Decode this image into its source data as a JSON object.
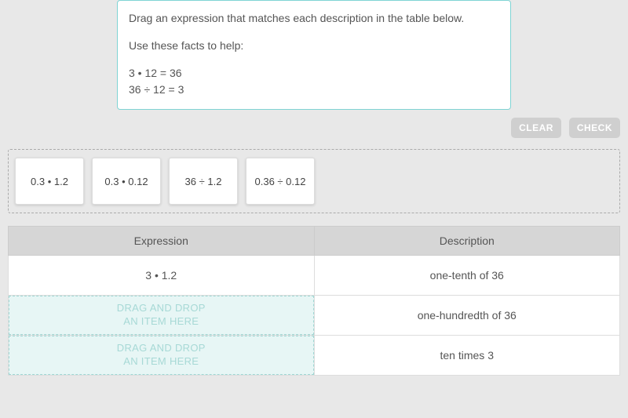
{
  "instructions": {
    "line1": "Drag an expression that matches each description in the table below.",
    "line2": "Use these facts to help:",
    "fact1": "3 • 12 = 36",
    "fact2": "36 ÷ 12 = 3"
  },
  "buttons": {
    "clear": "CLEAR",
    "check": "CHECK"
  },
  "cards": [
    "0.3 • 1.2",
    "0.3 • 0.12",
    "36 ÷ 1.2",
    "0.36 ÷ 0.12"
  ],
  "table": {
    "header_expression": "Expression",
    "header_description": "Description",
    "rows": [
      {
        "expression": "3 • 1.2",
        "description": "one-tenth of 36",
        "filled": true
      },
      {
        "expression": "",
        "description": "one-hundredth of 36",
        "filled": false
      },
      {
        "expression": "",
        "description": "ten times 3",
        "filled": false
      }
    ]
  },
  "dropzone": {
    "line1": "DRAG AND DROP",
    "line2": "AN ITEM HERE"
  }
}
